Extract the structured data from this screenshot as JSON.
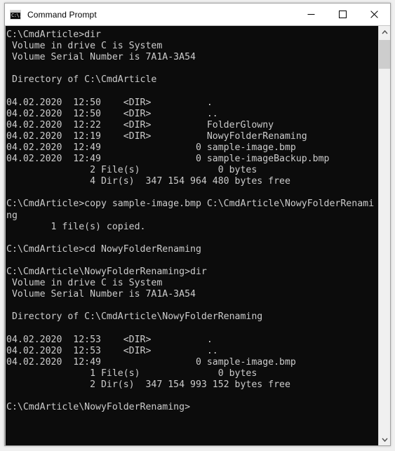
{
  "window": {
    "title": "Command Prompt",
    "icon": "command-prompt-icon",
    "icon_glyph": "C:\\.",
    "controls": {
      "minimize_label": "Minimize",
      "maximize_label": "Maximize",
      "close_label": "Close"
    }
  },
  "colors": {
    "console_background": "#0c0c0c",
    "console_foreground": "#cccccc",
    "titlebar_background": "#ffffff",
    "titlebar_foreground": "#000000",
    "scrollbar_track": "#f0f0f0",
    "scrollbar_thumb": "#cdcdcd",
    "close_hover": "#e81123"
  },
  "scrollbar": {
    "up_arrow": "chevron-up-icon",
    "down_arrow": "chevron-down-icon",
    "thumb_position_percent": 1,
    "thumb_size_percent": 8
  },
  "console": {
    "prompt_current": "C:\\CmdArticle\\NowyFolderRenaming>",
    "volume_label": "System",
    "volume_serial": "7A1A-3A54",
    "lines": [
      "C:\\CmdArticle>dir",
      " Volume in drive C is System",
      " Volume Serial Number is 7A1A-3A54",
      "",
      " Directory of C:\\CmdArticle",
      "",
      "04.02.2020  12:50    <DIR>          .",
      "04.02.2020  12:50    <DIR>          ..",
      "04.02.2020  12:22    <DIR>          FolderGlowny",
      "04.02.2020  12:19    <DIR>          NowyFolderRenaming",
      "04.02.2020  12:49                 0 sample-image.bmp",
      "04.02.2020  12:49                 0 sample-imageBackup.bmp",
      "               2 File(s)              0 bytes",
      "               4 Dir(s)  347 154 964 480 bytes free",
      "",
      "C:\\CmdArticle>copy sample-image.bmp C:\\CmdArticle\\NowyFolderRenami",
      "ng",
      "        1 file(s) copied.",
      "",
      "C:\\CmdArticle>cd NowyFolderRenaming",
      "",
      "C:\\CmdArticle\\NowyFolderRenaming>dir",
      " Volume in drive C is System",
      " Volume Serial Number is 7A1A-3A54",
      "",
      " Directory of C:\\CmdArticle\\NowyFolderRenaming",
      "",
      "04.02.2020  12:53    <DIR>          .",
      "04.02.2020  12:53    <DIR>          ..",
      "04.02.2020  12:49                 0 sample-image.bmp",
      "               1 File(s)              0 bytes",
      "               2 Dir(s)  347 154 993 152 bytes free",
      "",
      "C:\\CmdArticle\\NowyFolderRenaming>"
    ]
  }
}
